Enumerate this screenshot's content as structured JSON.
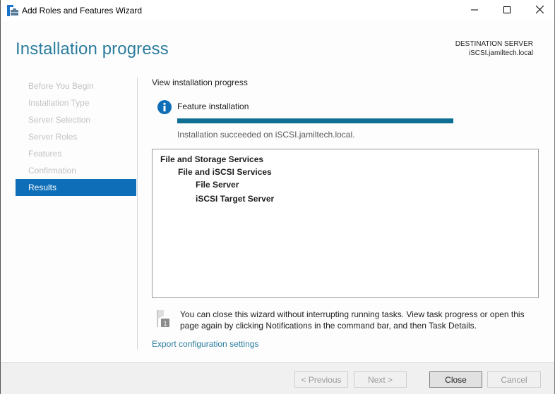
{
  "window": {
    "title": "Add Roles and Features Wizard",
    "icon": "server-manager-icon",
    "controls": {
      "minimize": "minimize-icon",
      "maximize": "maximize-icon",
      "close": "close-icon"
    }
  },
  "header": {
    "page_title": "Installation progress",
    "destination_label": "DESTINATION SERVER",
    "destination_server": "iSCSI.jamiltech.local"
  },
  "sidebar": {
    "items": [
      {
        "label": "Before You Begin",
        "active": false
      },
      {
        "label": "Installation Type",
        "active": false
      },
      {
        "label": "Server Selection",
        "active": false
      },
      {
        "label": "Server Roles",
        "active": false
      },
      {
        "label": "Features",
        "active": false
      },
      {
        "label": "Confirmation",
        "active": false
      },
      {
        "label": "Results",
        "active": true
      }
    ]
  },
  "main": {
    "section_label": "View installation progress",
    "feature_label": "Feature installation",
    "progress_percent": 100,
    "progress_color": "#0f6e93",
    "status_text": "Installation succeeded on iSCSI.jamiltech.local.",
    "results_tree": [
      {
        "label": "File and Storage Services",
        "level": 0
      },
      {
        "label": "File and iSCSI Services",
        "level": 1
      },
      {
        "label": "File Server",
        "level": 2
      },
      {
        "label": "iSCSI Target Server",
        "level": 2
      }
    ],
    "notice_text": "You can close this wizard without interrupting running tasks. View task progress or open this page again by clicking Notifications in the command bar, and then Task Details.",
    "notice_badge": "1",
    "export_link": "Export configuration settings"
  },
  "footer": {
    "previous_label": "< Previous",
    "next_label": "Next >",
    "close_label": "Close",
    "cancel_label": "Cancel"
  },
  "colors": {
    "accent": "#2b7d9d",
    "active_nav": "#0e6eb8",
    "info_icon": "#0e6eb8"
  }
}
